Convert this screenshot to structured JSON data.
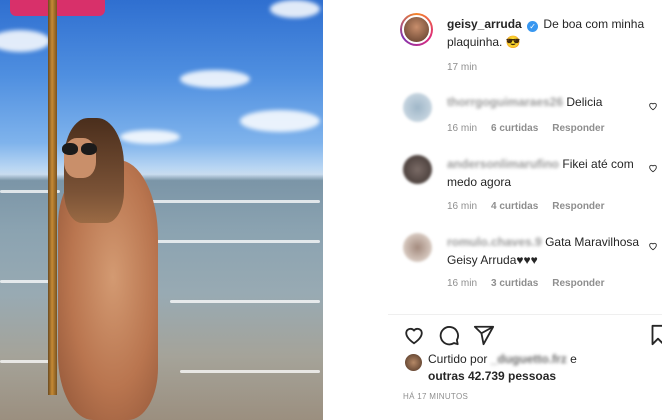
{
  "post": {
    "username": "geisy_arruda",
    "caption": "De boa com minha plaquinha. 😎",
    "time": "17 min"
  },
  "comments": [
    {
      "user": "thorrgoguimaraes26",
      "text": "Delicia",
      "time": "16 min",
      "likes": "6 curtidas",
      "reply": "Responder"
    },
    {
      "user": "andersonlimarufino",
      "text": "Fikei até com medo agora",
      "time": "16 min",
      "likes": "4 curtidas",
      "reply": "Responder"
    },
    {
      "user": "romulo.chaves.9",
      "text": "Gata Maravilhosa Geisy Arruda♥♥♥",
      "time": "16 min",
      "likes": "3 curtidas",
      "reply": "Responder"
    }
  ],
  "likes": {
    "prefix": "Curtido por",
    "liker": "_duguetto.frz",
    "suffix": "e",
    "others": "outras 42.739 pessoas"
  },
  "timestamp": "HÁ 17 MINUTOS",
  "icons": {
    "like": "heart-icon",
    "comment": "comment-icon",
    "share": "share-icon",
    "save": "bookmark-icon",
    "verified": "verified-badge-icon"
  },
  "colors": {
    "verified": "#3897f0",
    "muted": "#8e8e8e",
    "text": "#262626"
  }
}
